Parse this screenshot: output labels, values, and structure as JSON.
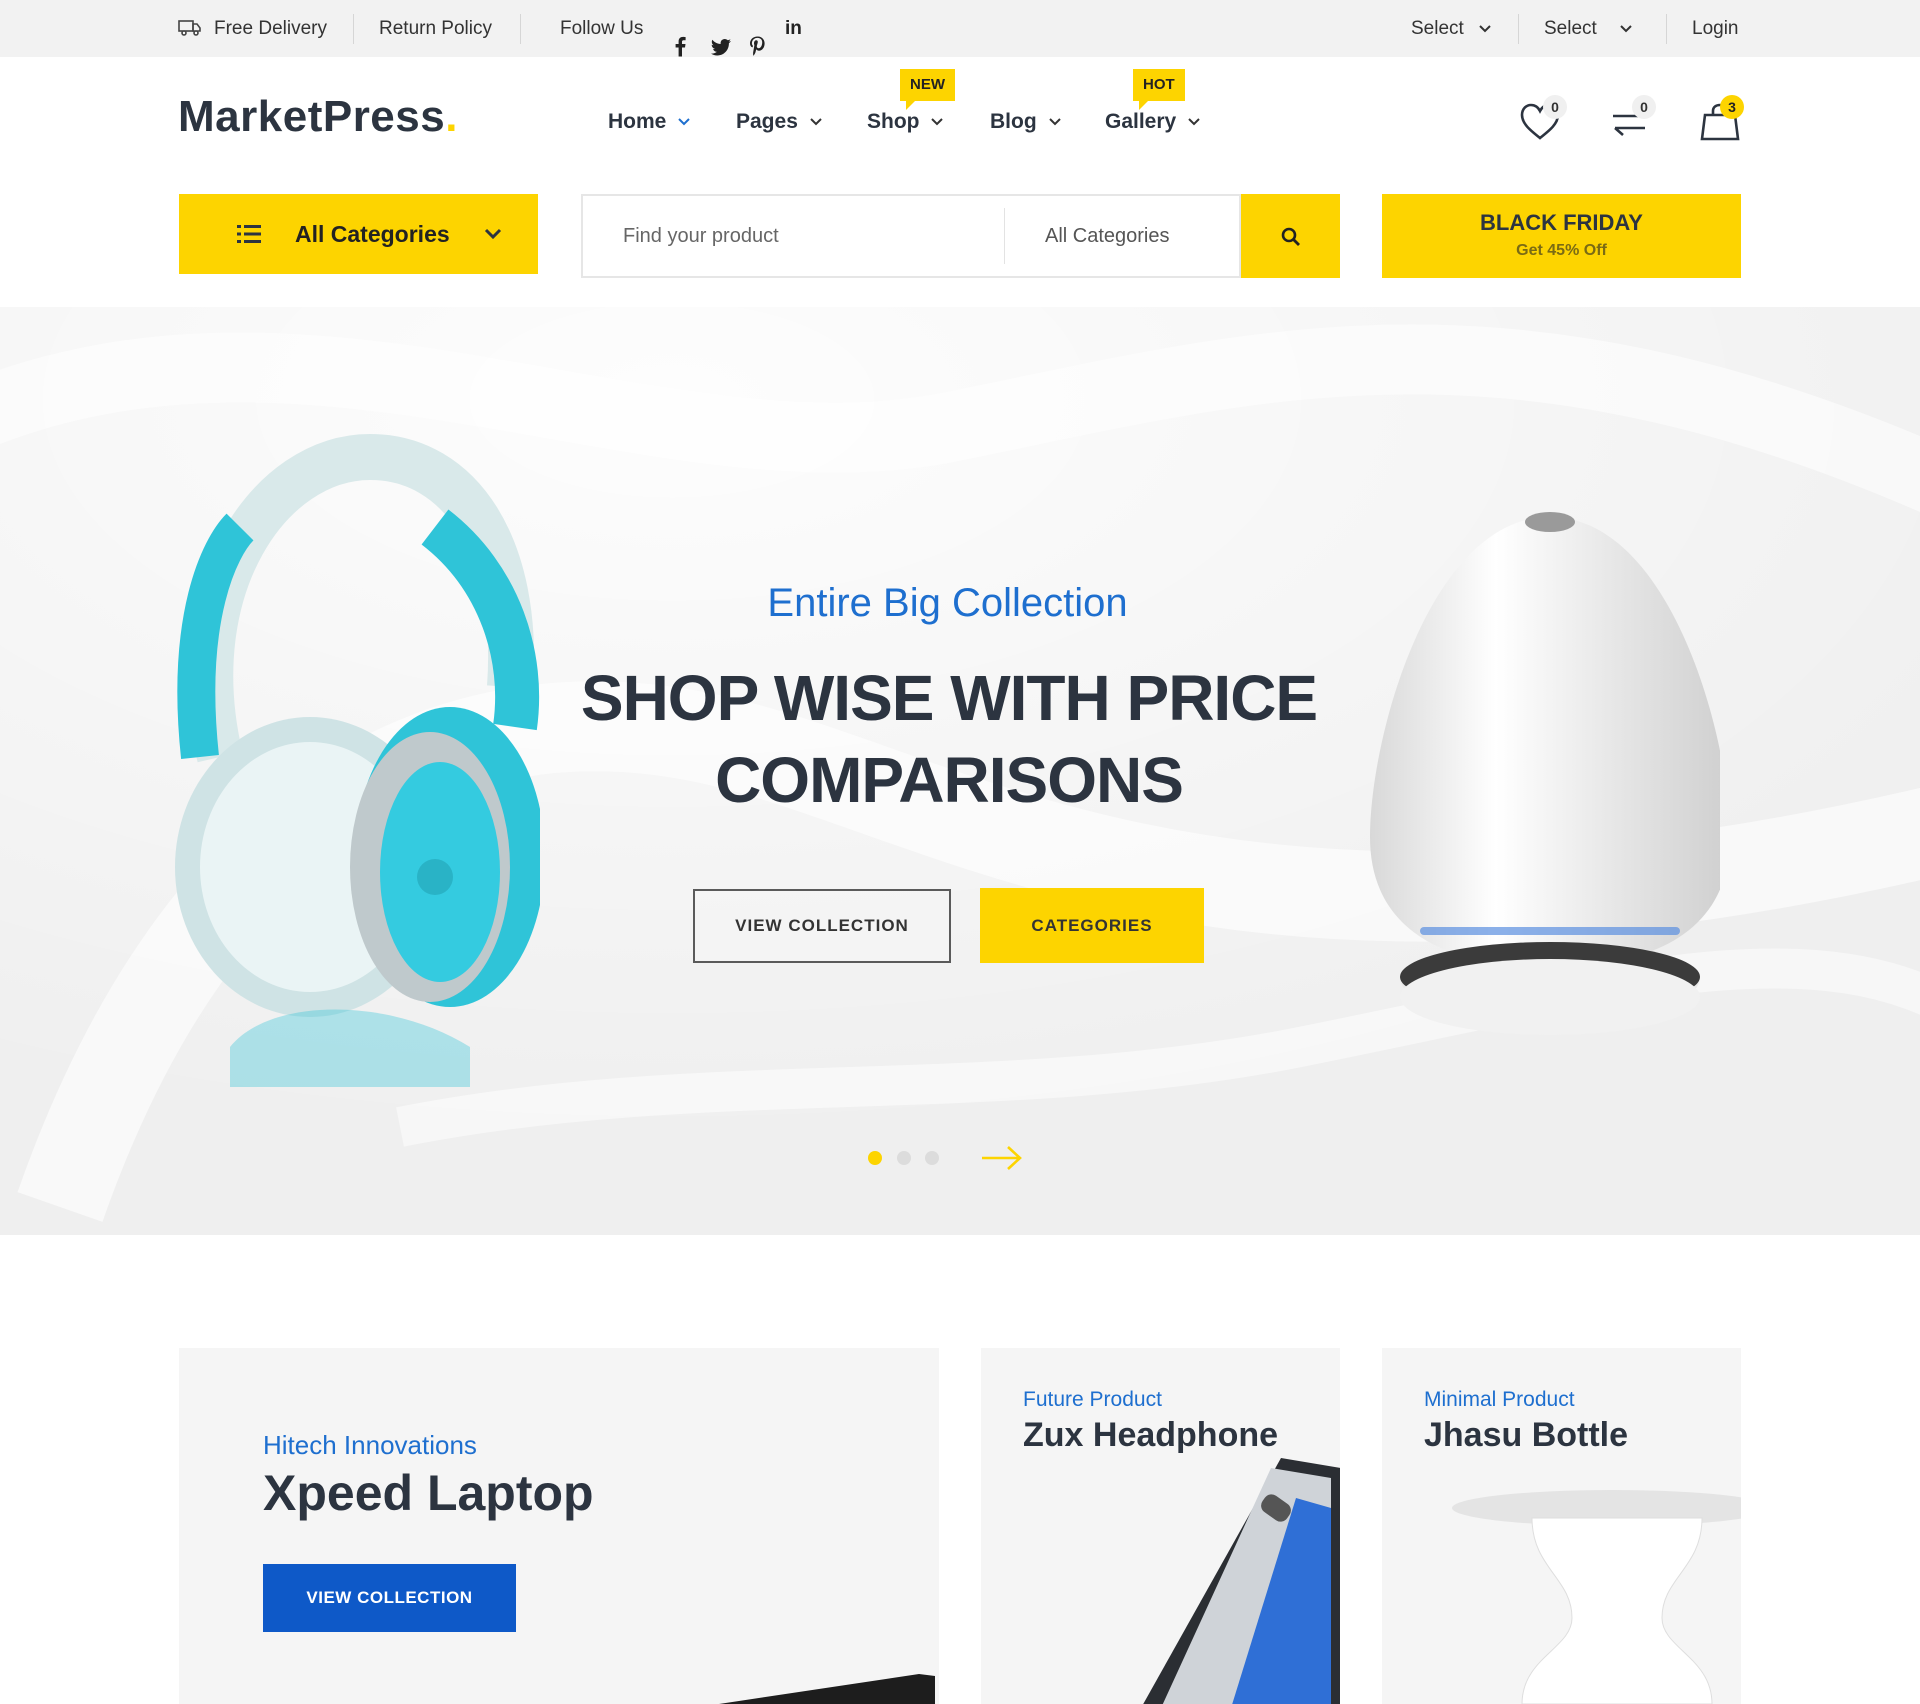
{
  "topbar": {
    "free_delivery": "Free Delivery",
    "return_policy": "Return Policy",
    "follow_us": "Follow Us",
    "social": [
      "facebook-icon",
      "twitter-icon",
      "pinterest-icon",
      "linkedin-icon"
    ],
    "linkedin_text": "in",
    "select_1": "Select",
    "select_2": "Select",
    "login": "Login"
  },
  "header": {
    "logo_text": "MarketPress",
    "logo_dot": ".",
    "nav": [
      {
        "label": "Home"
      },
      {
        "label": "Pages"
      },
      {
        "label": "Shop",
        "badge": "NEW"
      },
      {
        "label": "Blog"
      },
      {
        "label": "Gallery",
        "badge": "HOT"
      }
    ],
    "wishlist_count": "0",
    "compare_count": "0",
    "cart_count": "3"
  },
  "search": {
    "all_categories_label": "All Categories",
    "placeholder": "Find your product",
    "category_select": "All Categories",
    "black_friday_title": "BLACK FRIDAY",
    "black_friday_sub": "Get 45% Off"
  },
  "hero": {
    "subtitle": "Entire Big Collection",
    "title_line1": "SHOP WISE WITH PRICE",
    "title_line2": "COMPARISONS",
    "btn_view_collection": "VIEW COLLECTION",
    "btn_categories": "CATEGORIES",
    "slide_count": 3,
    "active_slide": 1
  },
  "cards": [
    {
      "tag": "Hitech Innovations",
      "title": "Xpeed Laptop",
      "button": "VIEW COLLECTION"
    },
    {
      "tag": "Future Product",
      "title": "Zux Headphone"
    },
    {
      "tag": "Minimal Product",
      "title": "Jhasu Bottle"
    }
  ],
  "colors": {
    "accent_yellow": "#fdd400",
    "accent_blue": "#1e6fcf",
    "button_blue": "#0e59c8",
    "text_dark": "#2c3440",
    "topbar_bg": "#f2f2f2"
  }
}
